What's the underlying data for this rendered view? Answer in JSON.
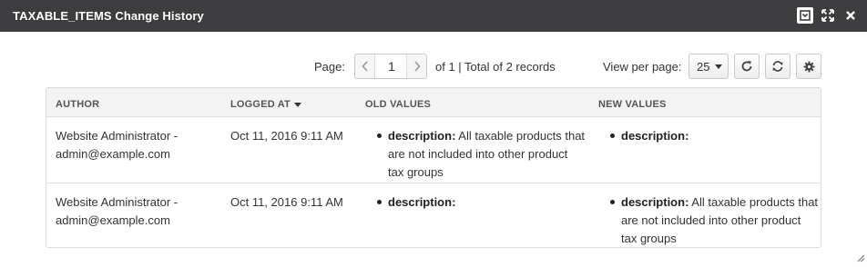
{
  "window": {
    "title": "TAXABLE_ITEMS Change History"
  },
  "pager": {
    "page_label": "Page:",
    "current_page": "1",
    "total_text": "of 1 | Total of 2 records",
    "view_per_page_label": "View per page:",
    "per_page_value": "25"
  },
  "grid": {
    "columns": {
      "author": "AUTHOR",
      "logged_at": "LOGGED AT",
      "old_values": "OLD VALUES",
      "new_values": "NEW VALUES"
    },
    "rows": [
      {
        "author": "Website Administrator - admin@example.com",
        "logged_at": "Oct 11, 2016 9:11 AM",
        "old_key": "description:",
        "old_value": " All taxable products that are not included into other product tax groups",
        "new_key": "description:",
        "new_value": ""
      },
      {
        "author": "Website Administrator - admin@example.com",
        "logged_at": "Oct 11, 2016 9:11 AM",
        "old_key": "description:",
        "old_value": "",
        "new_key": "description:",
        "new_value": " All taxable products that are not included into other product tax groups"
      }
    ]
  },
  "icons": {
    "minimize": "minimize-icon",
    "maximize": "maximize-icon",
    "close": "close-icon",
    "prev": "chevron-left-icon",
    "next": "chevron-right-icon",
    "refresh": "refresh-icon",
    "reset": "reset-icon",
    "settings": "gear-icon"
  },
  "colors": {
    "titlebar": "#3d3d3f",
    "header_bg": "#f3f3f3"
  }
}
